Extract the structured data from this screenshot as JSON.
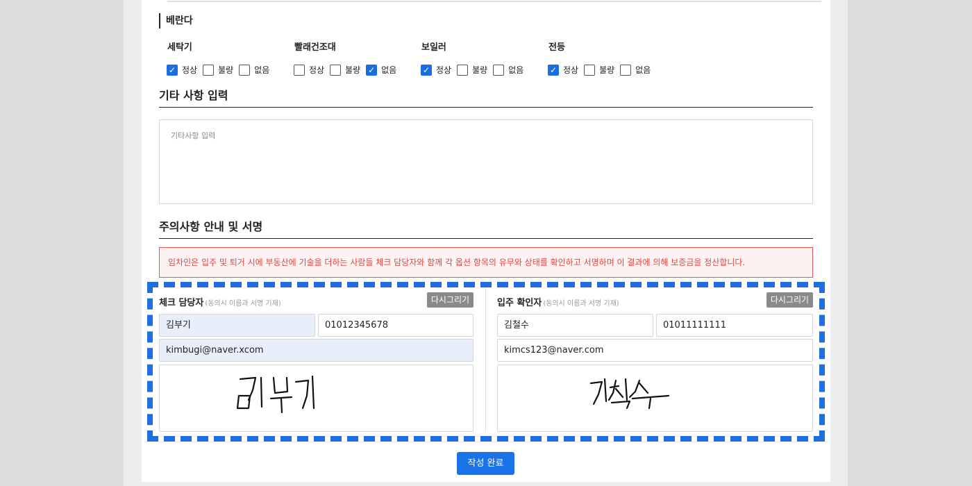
{
  "balcony": {
    "section_title": "베란다",
    "groups": [
      {
        "title": "세탁기",
        "options": [
          {
            "label": "정상",
            "checked": true
          },
          {
            "label": "불량",
            "checked": false
          },
          {
            "label": "없음",
            "checked": false
          }
        ]
      },
      {
        "title": "빨래건조대",
        "options": [
          {
            "label": "정상",
            "checked": false
          },
          {
            "label": "불량",
            "checked": false
          },
          {
            "label": "없음",
            "checked": true
          }
        ]
      },
      {
        "title": "보일러",
        "options": [
          {
            "label": "정상",
            "checked": true
          },
          {
            "label": "불량",
            "checked": false
          },
          {
            "label": "없음",
            "checked": false
          }
        ]
      },
      {
        "title": "전등",
        "options": [
          {
            "label": "정상",
            "checked": true
          },
          {
            "label": "불량",
            "checked": false
          },
          {
            "label": "없음",
            "checked": false
          }
        ]
      }
    ]
  },
  "memo": {
    "title": "기타 사항 입력",
    "placeholder": "기타사항 입력"
  },
  "notice": {
    "title": "주의사항 안내 및 서명",
    "text": "임차인은 입주 및 퇴거 시에 부동산에 기술을 더하는 사람들 체크 담당자와 함께 각 옵션 항목의 유무와 상태를 확인하고 서명하며 이 결과에 의해 보증금을 정산합니다."
  },
  "checker": {
    "title": "체크 담당자",
    "subtitle": "(동의시 이름과 서명 기재)",
    "redraw_label": "다시그리기",
    "name": "김부기",
    "phone": "01012345678",
    "email": "kimbugi@naver.xcom"
  },
  "tenant": {
    "title": "입주 확인자",
    "subtitle": "(동의시 이름과 서명 기재)",
    "redraw_label": "다시그리기",
    "name": "김철수",
    "phone": "01011111111",
    "email": "kimcs123@naver.com"
  },
  "submit_label": "작성 완료",
  "colors": {
    "accent": "#1a73e8",
    "notice": "#e04545",
    "highlight": "#1f6ee0"
  }
}
